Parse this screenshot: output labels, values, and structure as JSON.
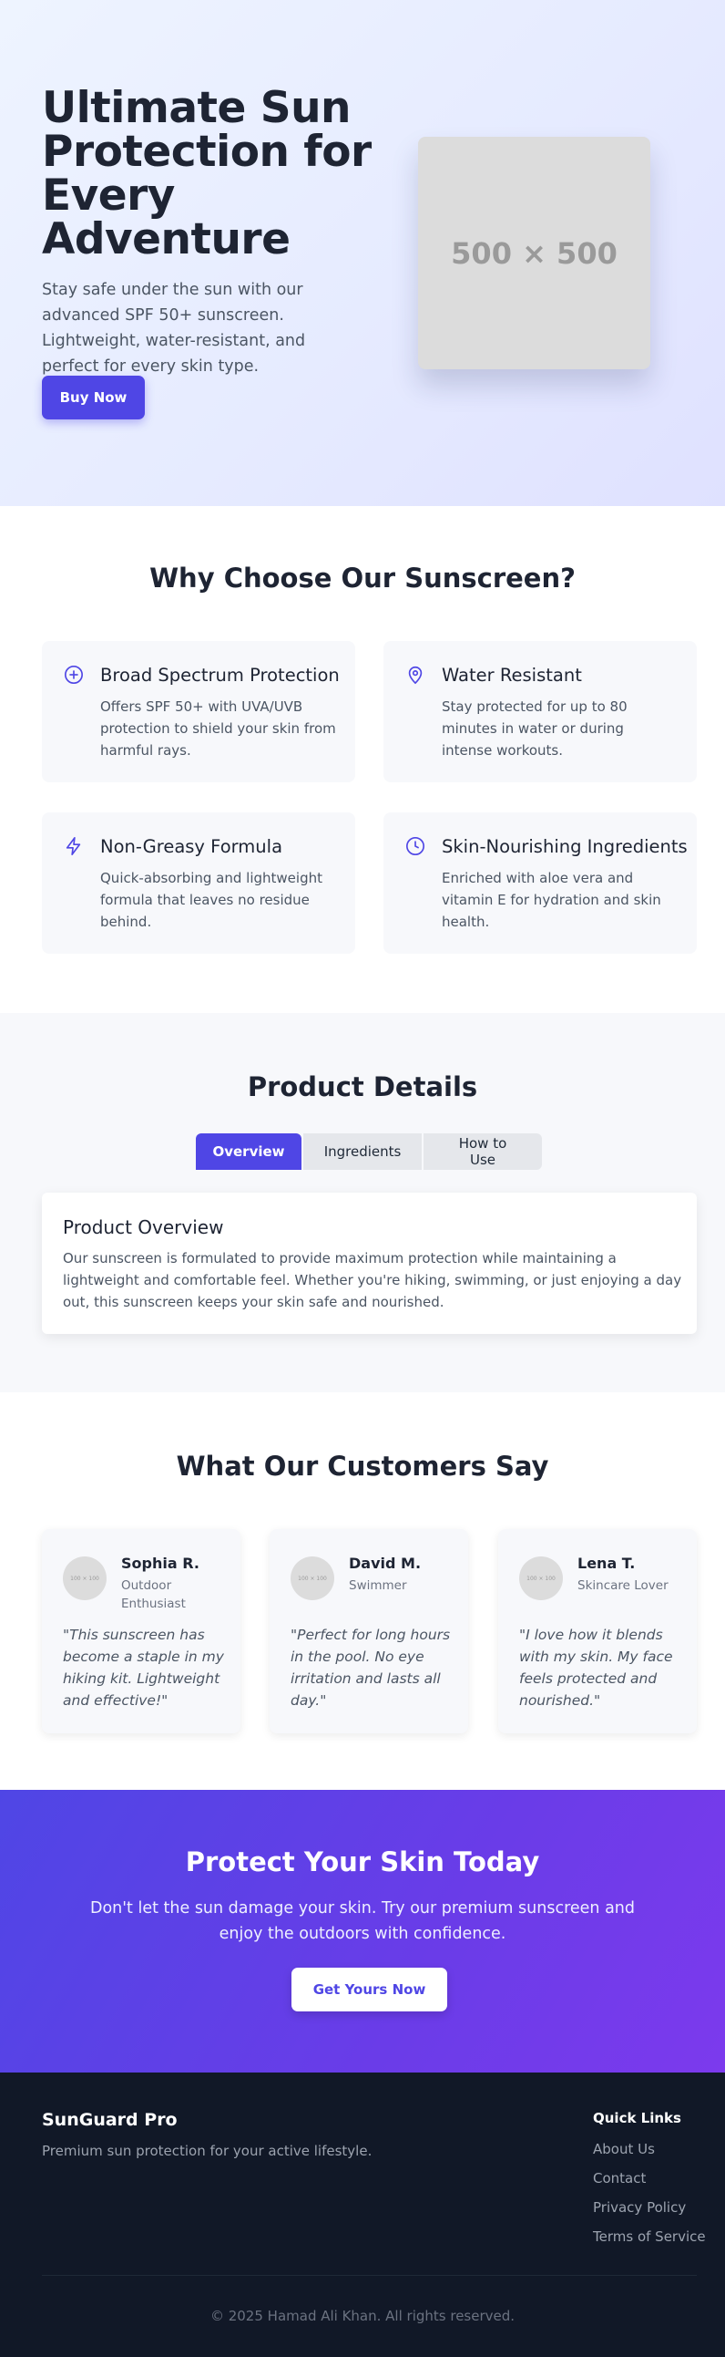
{
  "hero": {
    "title": "Ultimate Sun Protection for Every Adventure",
    "subtitle": "Stay safe under the sun with our advanced SPF 50+ sunscreen. Lightweight, water-resistant, and perfect for every skin type.",
    "cta_label": "Buy Now",
    "image_placeholder": "500 × 500"
  },
  "features": {
    "title": "Why Choose Our Sunscreen?",
    "items": [
      {
        "icon": "plus-circle-icon",
        "title": "Broad Spectrum Protection",
        "desc": "Offers SPF 50+ with UVA/UVB protection to shield your skin from harmful rays."
      },
      {
        "icon": "location-pin-icon",
        "title": "Water Resistant",
        "desc": "Stay protected for up to 80 minutes in water or during intense workouts."
      },
      {
        "icon": "lightning-icon",
        "title": "Non-Greasy Formula",
        "desc": "Quick-absorbing and lightweight formula that leaves no residue behind."
      },
      {
        "icon": "clock-icon",
        "title": "Skin-Nourishing Ingredients",
        "desc": "Enriched with aloe vera and vitamin E for hydration and skin health."
      }
    ]
  },
  "details": {
    "title": "Product Details",
    "tabs": [
      "Overview",
      "Ingredients",
      "How to Use"
    ],
    "active_tab": "Overview",
    "panel_title": "Product Overview",
    "panel_text": "Our sunscreen is formulated to provide maximum protection while maintaining a lightweight and comfortable feel. Whether you're hiking, swimming, or just enjoying a day out, this sunscreen keeps your skin safe and nourished."
  },
  "testimonials": {
    "title": "What Our Customers Say",
    "items": [
      {
        "avatar": "100 × 100",
        "name": "Sophia R.",
        "role": "Outdoor Enthusiast",
        "quote": "\"This sunscreen has become a staple in my hiking kit. Lightweight and effective!\""
      },
      {
        "avatar": "100 × 100",
        "name": "David M.",
        "role": "Swimmer",
        "quote": "\"Perfect for long hours in the pool. No eye irritation and lasts all day.\""
      },
      {
        "avatar": "100 × 100",
        "name": "Lena T.",
        "role": "Skincare Lover",
        "quote": "\"I love how it blends with my skin. My face feels protected and nourished.\""
      }
    ]
  },
  "cta": {
    "title": "Protect Your Skin Today",
    "text": "Don't let the sun damage your skin. Try our premium sunscreen and enjoy the outdoors with confidence.",
    "button_label": "Get Yours Now"
  },
  "footer": {
    "brand": "SunGuard Pro",
    "tagline": "Premium sun protection for your active lifestyle.",
    "quick_links_title": "Quick Links",
    "links": [
      "About Us",
      "Contact",
      "Privacy Policy",
      "Terms of Service"
    ],
    "copyright": "© 2025 Hamad Ali Khan. All rights reserved."
  },
  "colors": {
    "accent": "#4f46e5",
    "accent_purple": "#7c3aed",
    "dark": "#111827"
  }
}
